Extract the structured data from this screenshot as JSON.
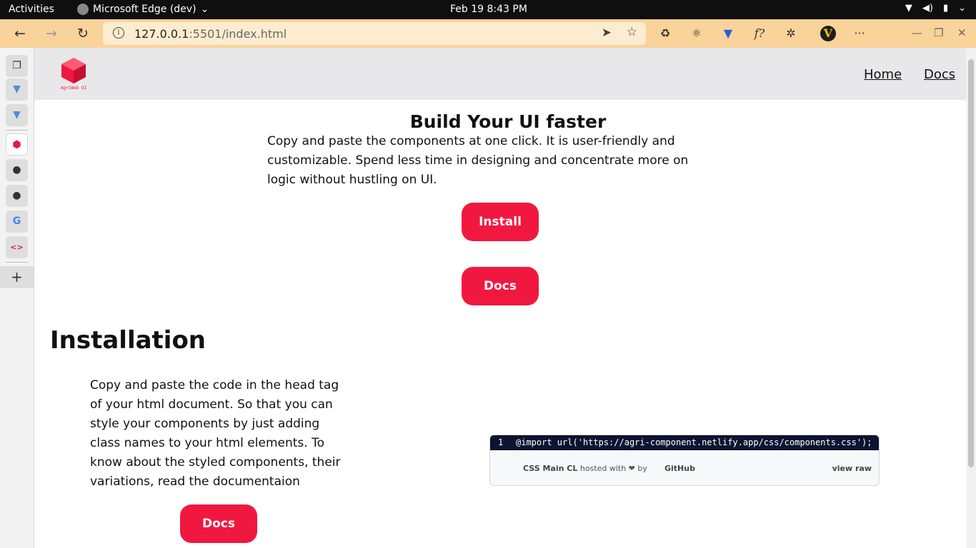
{
  "os_bar": {
    "activities": "Activities",
    "app_name": "Microsoft Edge (dev)",
    "clock": "Feb 19  8:43 PM"
  },
  "browser": {
    "url_host": "127.0.0.1",
    "url_rest": ":5501/index.html",
    "menu": "···"
  },
  "site": {
    "logo_text": "AgriWeb UI",
    "nav": {
      "home": "Home",
      "docs": "Docs"
    },
    "hero": {
      "title": "Build Your UI faster",
      "text": "Copy and paste the components at one click. It is user-friendly and customizable. Spend less time in designing and concentrate more on logic without hustling on UI.",
      "install_button": "Install",
      "docs_button": "Docs"
    },
    "installation": {
      "title": "Installation",
      "text": "Copy and paste the code in the head tag of your html document. So that you can style your components by just adding class names to your html elements. To know about the styled components, their variations, read the documentaion",
      "docs_button": "Docs"
    },
    "gist": {
      "line_number": "1",
      "code": "@import url('https://agri-component.netlify.app/css/components.css');",
      "file_name": "CSS Main CL",
      "hosted_with": "hosted with ❤ by",
      "github": "GitHub",
      "view_raw": "view raw"
    }
  },
  "colors": {
    "accent": "#f1183f",
    "browser_toolbar": "#f9d39a",
    "navbar": "#e8e8ea",
    "gist_code_bg": "#0b1430"
  }
}
